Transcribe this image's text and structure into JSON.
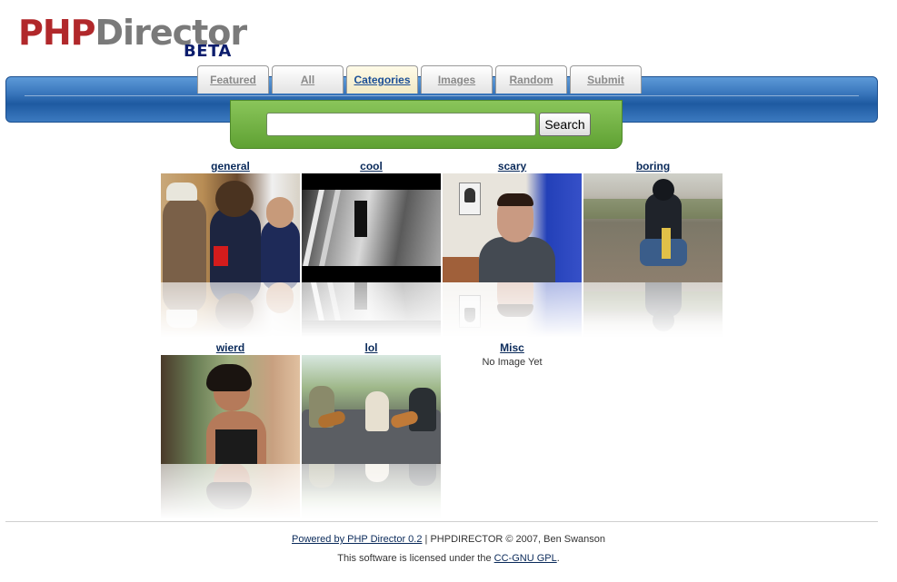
{
  "logo": {
    "php": "PHP",
    "director": "Director",
    "beta": "BETA"
  },
  "nav": {
    "tabs": [
      {
        "label": "Featured",
        "active": false
      },
      {
        "label": "All",
        "active": false
      },
      {
        "label": "Categories",
        "active": true
      },
      {
        "label": "Images",
        "active": false
      },
      {
        "label": "Random",
        "active": false
      },
      {
        "label": "Submit",
        "active": false
      }
    ]
  },
  "search": {
    "placeholder": "",
    "value": "",
    "button_label": "Search"
  },
  "categories": [
    {
      "title": "general",
      "has_image": true
    },
    {
      "title": "cool",
      "has_image": true
    },
    {
      "title": "scary",
      "has_image": true
    },
    {
      "title": "boring",
      "has_image": true
    },
    {
      "title": "wierd",
      "has_image": true
    },
    {
      "title": "lol",
      "has_image": true
    },
    {
      "title": "Misc",
      "has_image": false,
      "no_image_text": "No Image Yet"
    }
  ],
  "footer": {
    "powered_link": "Powered by PHP Director 0.2",
    "separator": "|",
    "copyright": "PHPDIRECTOR © 2007, Ben Swanson",
    "license_prefix": "This software is licensed under the",
    "license_link": "CC-GNU GPL",
    "license_suffix": "."
  },
  "colors": {
    "logo_php": "#b1282b",
    "logo_director": "#7a7a7a",
    "logo_beta": "#0c1d6d",
    "header_blue": "#3b78bd",
    "search_green": "#6fb040",
    "link": "#0a2a5a"
  }
}
